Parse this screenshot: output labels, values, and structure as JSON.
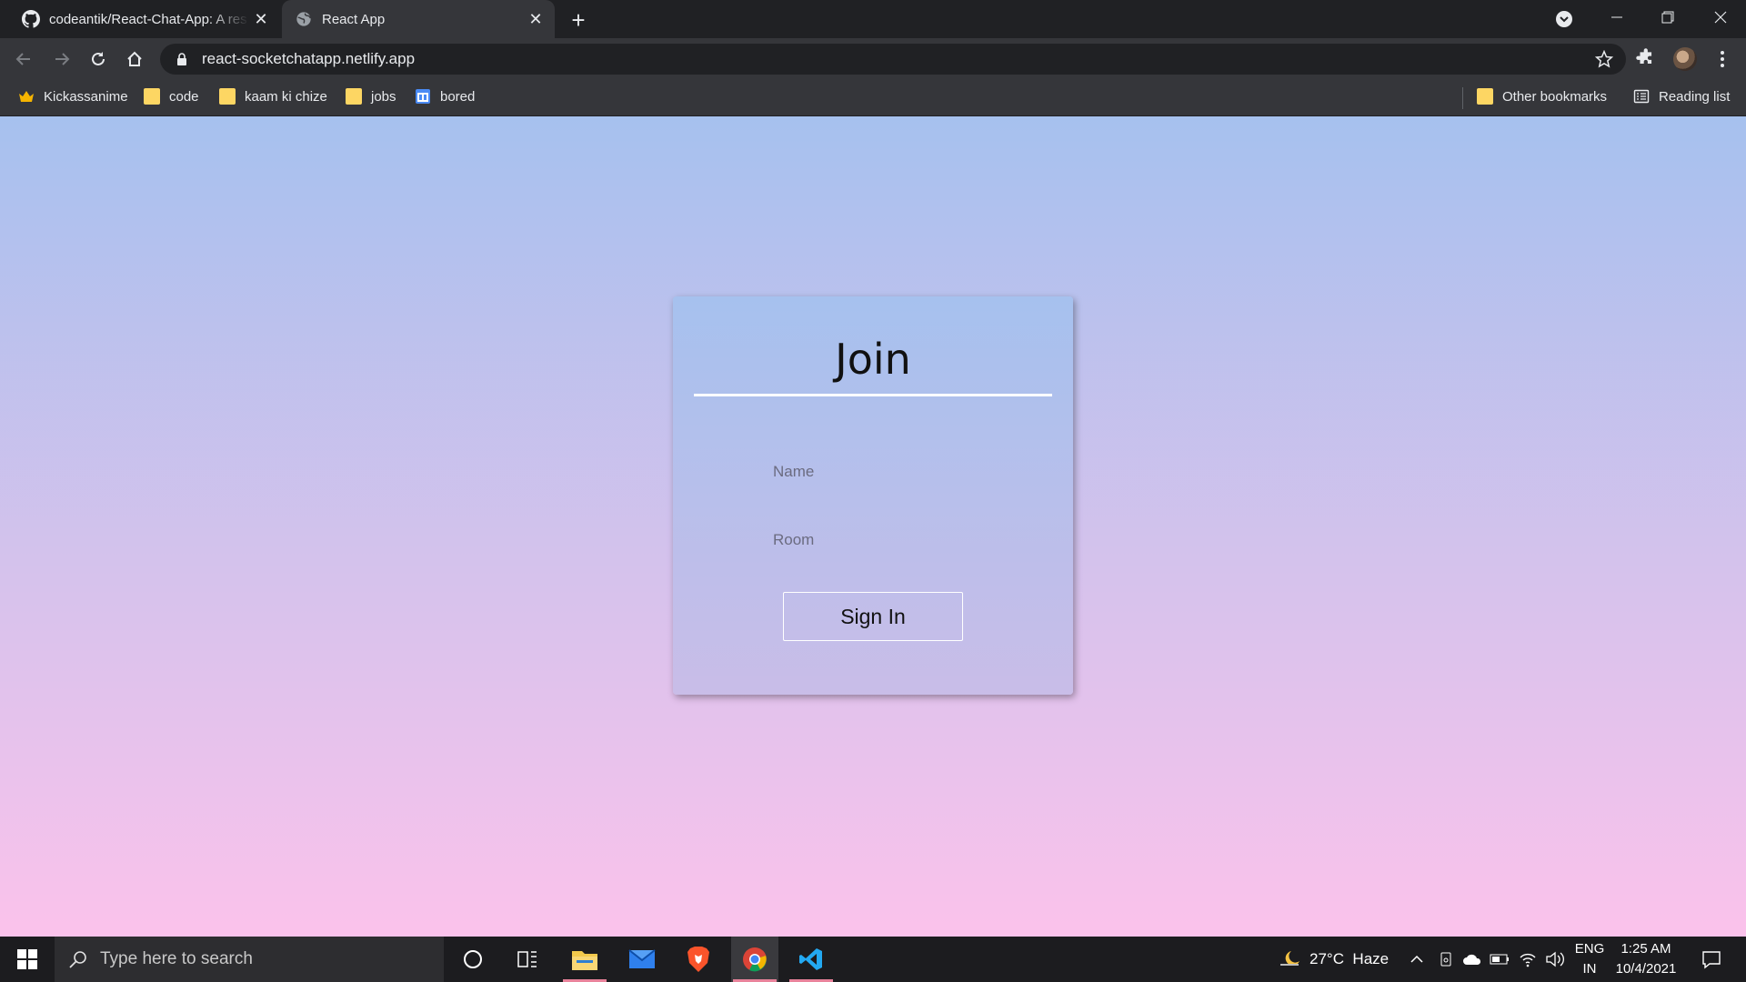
{
  "browser": {
    "tabs": [
      {
        "title": "codeantik/React-Chat-App: A res",
        "active": false,
        "icon": "github-icon"
      },
      {
        "title": "React App",
        "active": true,
        "icon": "globe-icon"
      }
    ],
    "url": "react-socketchatapp.netlify.app",
    "bookmarks": [
      {
        "label": "Kickassanime",
        "icon": "crown-icon"
      },
      {
        "label": "code",
        "icon": "folder-icon"
      },
      {
        "label": "kaam ki chize",
        "icon": "folder-icon"
      },
      {
        "label": "jobs",
        "icon": "folder-icon"
      },
      {
        "label": "bored",
        "icon": "calendar-icon"
      }
    ],
    "other_bookmarks": "Other bookmarks",
    "reading_list": "Reading list"
  },
  "page": {
    "title": "Join",
    "name_placeholder": "Name",
    "room_placeholder": "Room",
    "signin_label": "Sign In",
    "gradient_top": "#a6c1ee",
    "gradient_bottom": "#fbc2eb"
  },
  "taskbar": {
    "search_placeholder": "Type here to search",
    "apps": [
      "cortana-icon",
      "task-view-icon",
      "file-explorer-icon",
      "mail-icon",
      "brave-icon",
      "chrome-icon",
      "vscode-icon"
    ],
    "weather": "27°C  Haze",
    "language": "ENG",
    "region": "IN",
    "time": "1:25 AM",
    "date": "10/4/2021"
  }
}
